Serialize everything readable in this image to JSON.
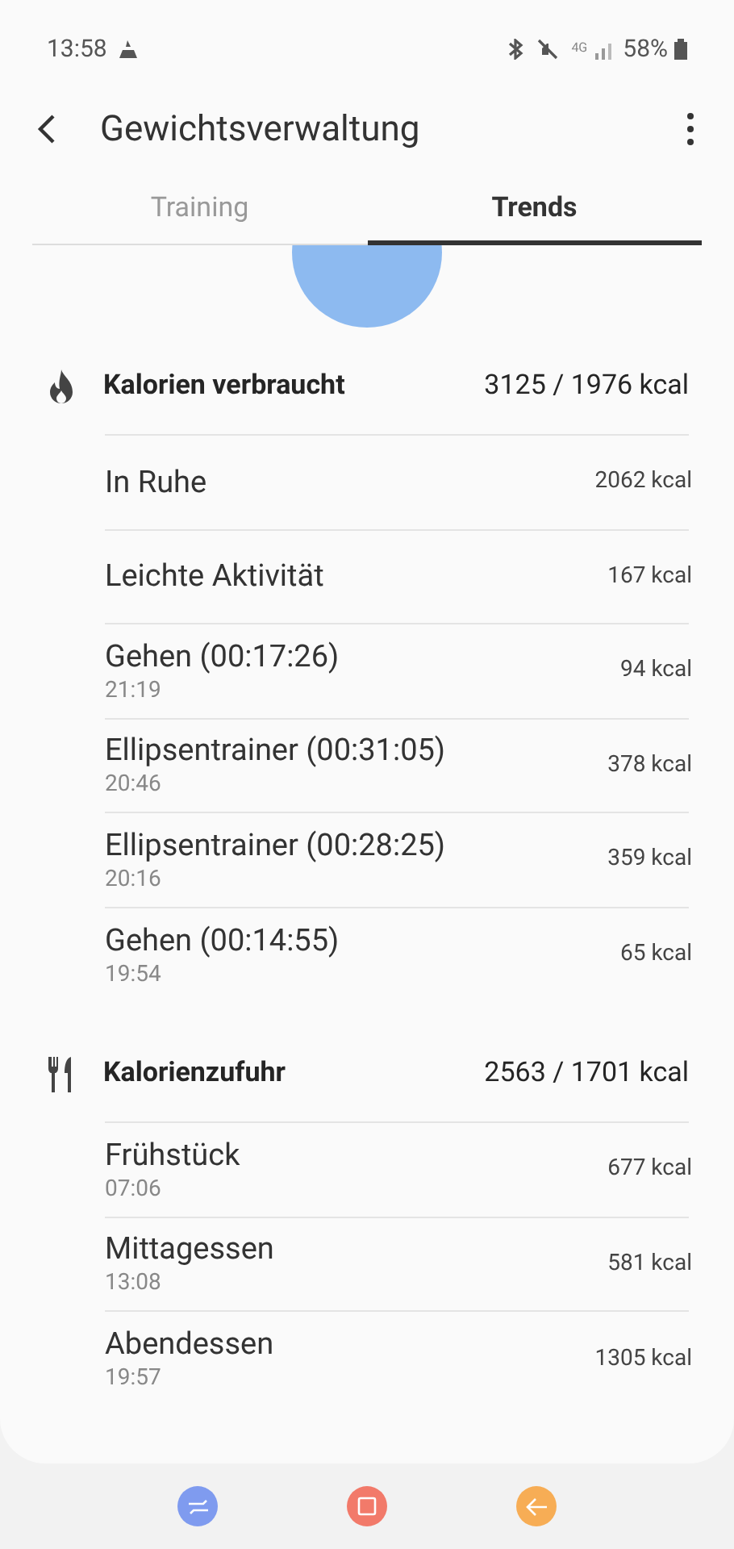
{
  "status_bar": {
    "time": "13:58",
    "battery": "58%",
    "network": "4G"
  },
  "header": {
    "title": "Gewichtsverwaltung"
  },
  "tabs": [
    {
      "label": "Training",
      "selected": false
    },
    {
      "label": "Trends",
      "selected": true
    }
  ],
  "sections": [
    {
      "kind": "burned",
      "title": "Kalorien verbraucht",
      "total": "3125 / 1976 kcal",
      "rows": [
        {
          "title": "In Ruhe",
          "value": "2062 kcal"
        },
        {
          "title": "Leichte Aktivität",
          "value": "167 kcal"
        },
        {
          "title": "Gehen (00:17:26)",
          "time": "21:19",
          "value": "94 kcal"
        },
        {
          "title": "Ellipsentrainer (00:31:05)",
          "time": "20:46",
          "value": "378 kcal"
        },
        {
          "title": "Ellipsentrainer (00:28:25)",
          "time": "20:16",
          "value": "359 kcal"
        },
        {
          "title": "Gehen (00:14:55)",
          "time": "19:54",
          "value": "65 kcal"
        }
      ]
    },
    {
      "kind": "intake",
      "title": "Kalorienzufuhr",
      "total": "2563 / 1701 kcal",
      "rows": [
        {
          "title": "Frühstück",
          "time": "07:06",
          "value": "677 kcal"
        },
        {
          "title": "Mittagessen",
          "time": "13:08",
          "value": "581 kcal"
        },
        {
          "title": "Abendessen",
          "time": "19:57",
          "value": "1305 kcal"
        }
      ]
    }
  ]
}
